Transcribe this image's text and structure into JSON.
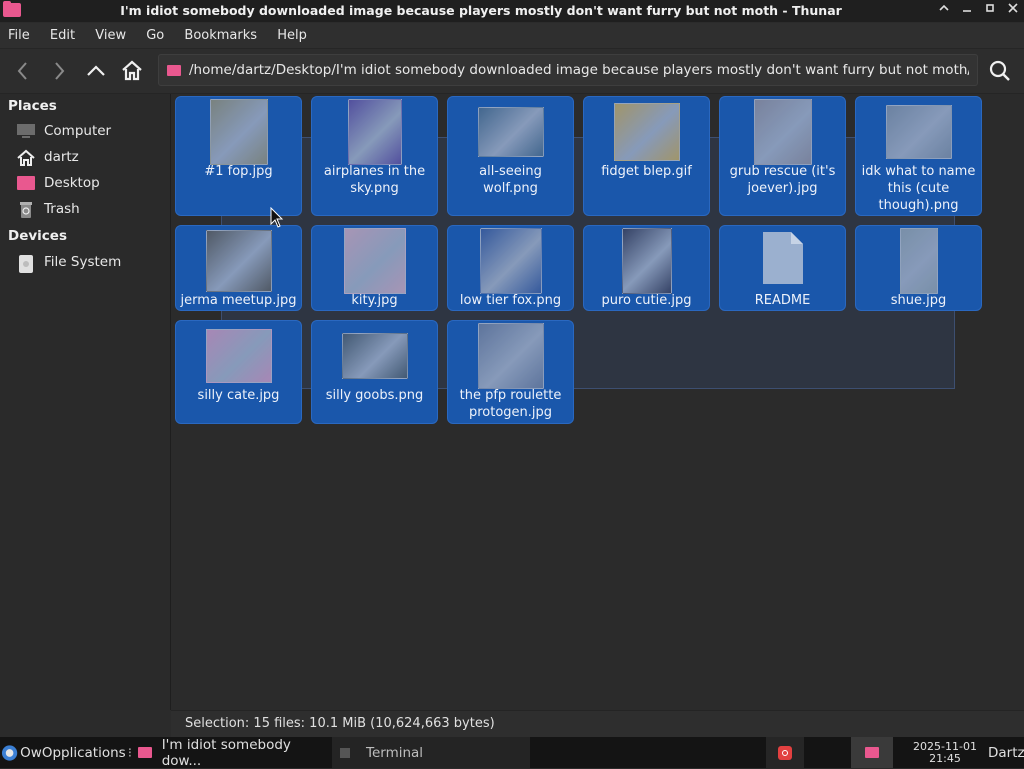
{
  "window": {
    "title": "I'm idiot somebody downloaded image because players mostly don't want furry but not moth - Thunar",
    "controls": {
      "minimize": "⌃",
      "iconify": "—",
      "maximize": "▫",
      "close": "✕"
    }
  },
  "menubar": [
    "File",
    "Edit",
    "View",
    "Go",
    "Bookmarks",
    "Help"
  ],
  "toolbar": {
    "path": "/home/dartz/Desktop/I'm idiot somebody downloaded image because players mostly don't want furry but not moth/"
  },
  "sidebar": {
    "places_heading": "Places",
    "places": [
      {
        "label": "Computer",
        "icon": "computer-icon"
      },
      {
        "label": "dartz",
        "icon": "home-icon"
      },
      {
        "label": "Desktop",
        "icon": "folder-icon"
      },
      {
        "label": "Trash",
        "icon": "trash-icon"
      }
    ],
    "devices_heading": "Devices",
    "devices": [
      {
        "label": "File System",
        "icon": "drive-icon"
      }
    ]
  },
  "files": [
    {
      "name": "#1 fop.jpg",
      "thumb_color": "#8a8a78"
    },
    {
      "name": "airplanes in the sky.png",
      "thumb_color": "#5c4f9c"
    },
    {
      "name": "all-seeing wolf.png",
      "thumb_color": "#4a6a8a"
    },
    {
      "name": "fidget blep.gif",
      "thumb_color": "#b8a060"
    },
    {
      "name": "grub rescue (it's joever).jpg",
      "thumb_color": "#8a8a9a"
    },
    {
      "name": "idk what to name this (cute though).png",
      "thumb_color": "#7a8aa0"
    },
    {
      "name": "jerma meetup.jpg",
      "thumb_color": "#5a5a5a"
    },
    {
      "name": "kity.jpg",
      "thumb_color": "#c0a0b8"
    },
    {
      "name": "low tier fox.png",
      "thumb_color": "#3a5a9a"
    },
    {
      "name": "puro cutie.jpg",
      "thumb_color": "#3a3f5a"
    },
    {
      "name": "README",
      "thumb_color": "#9bb0cf",
      "is_document": true
    },
    {
      "name": "shue.jpg",
      "thumb_color": "#8a9aa8"
    },
    {
      "name": "silly cate.jpg",
      "thumb_color": "#c090b8"
    },
    {
      "name": "silly goobs.png",
      "thumb_color": "#4a5a6a"
    },
    {
      "name": "the pfp roulette protogen.jpg",
      "thumb_color": "#6a7a9a"
    }
  ],
  "statusbar": {
    "text": "Selection: 15 files: 10.1 MiB (10,624,663 bytes)"
  },
  "taskbar": {
    "start_label": "OwOpplications",
    "window_task": "I'm idiot somebody dow...",
    "terminal_task": "Terminal",
    "date": "2025-11-01",
    "time": "21:45",
    "user": "Dartz"
  },
  "colors": {
    "accent": "#e9588f",
    "selection": "#1a57ab",
    "background": "#2b2b2b"
  }
}
